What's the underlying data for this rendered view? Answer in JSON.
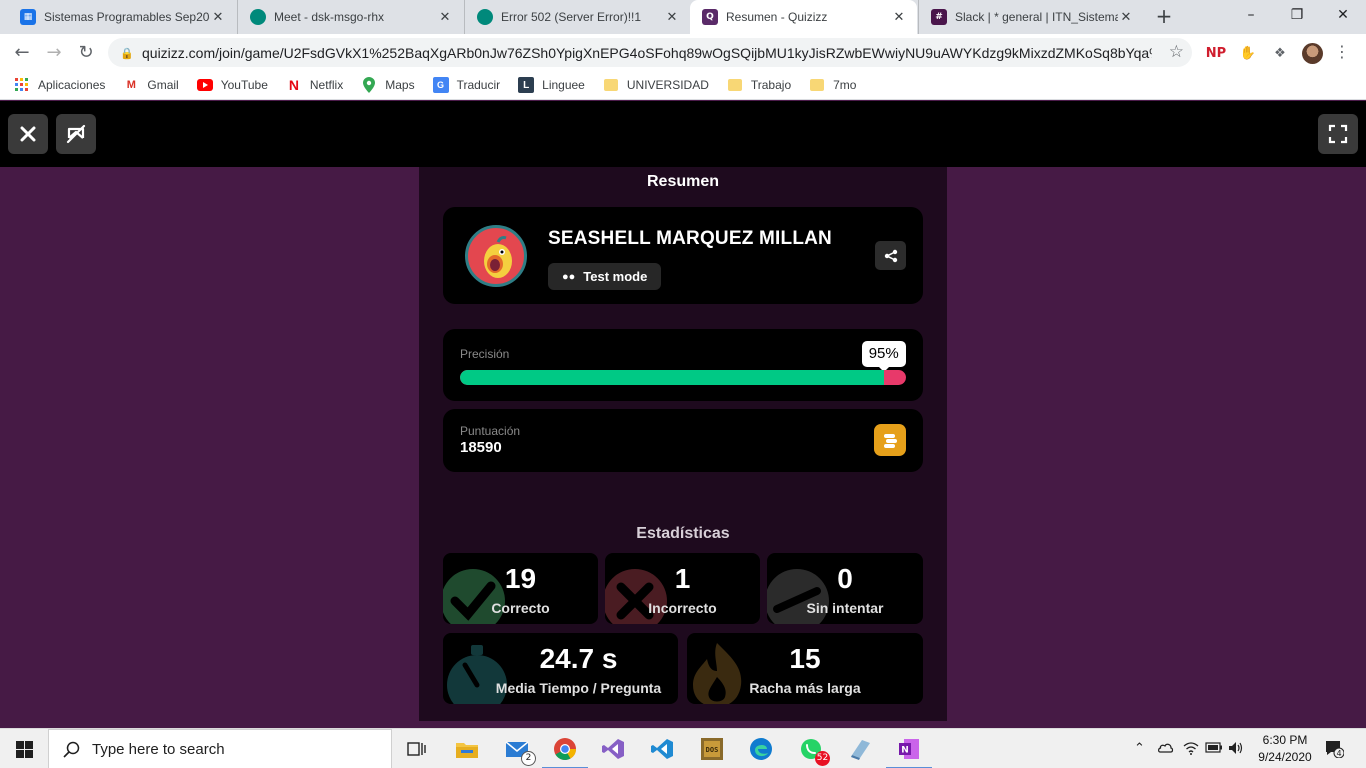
{
  "browser": {
    "tabs": [
      {
        "title": "Sistemas Programables Sep20-",
        "favicon_color": "#1a73e8",
        "icon": "classroom-icon"
      },
      {
        "title": "Meet - dsk-msgo-rhx",
        "favicon_color": "#00897b",
        "icon": "meet-icon"
      },
      {
        "title": "Error 502 (Server Error)!!1",
        "favicon_color": "#00897b",
        "icon": "meet-icon"
      },
      {
        "title": "Resumen - Quizizz",
        "favicon_color": "#5a2a68",
        "icon": "quizizz-icon"
      },
      {
        "title": "Slack | * general | ITN_Sistemas",
        "favicon_color": "#4a154b",
        "icon": "slack-icon"
      }
    ],
    "active_tab_index": 3,
    "url": "quizizz.com/join/game/U2FsdGVkX1%252BaqXgARb0nJw76ZSh0YpigXnEPG4oSFohq89wOgSQijbMU1kyJisRZwbEWwiyNU9uAWYKdzg9kMixzdZMKoSq8bYqa%25...",
    "extension_np": "NP",
    "bookmarks": [
      {
        "label": "Aplicaciones",
        "icon": "apps-grid-icon"
      },
      {
        "label": "Gmail",
        "icon": "gmail-icon"
      },
      {
        "label": "YouTube",
        "icon": "youtube-icon"
      },
      {
        "label": "Netflix",
        "icon": "netflix-icon"
      },
      {
        "label": "Maps",
        "icon": "maps-icon"
      },
      {
        "label": "Traducir",
        "icon": "translate-icon"
      },
      {
        "label": "Linguee",
        "icon": "linguee-icon"
      },
      {
        "label": "UNIVERSIDAD",
        "icon": "folder-icon"
      },
      {
        "label": "Trabajo",
        "icon": "folder-icon"
      },
      {
        "label": "7mo",
        "icon": "folder-icon"
      }
    ]
  },
  "summary": {
    "title": "Resumen",
    "player": {
      "name": "SEASHELL MARQUEZ MILLAN",
      "mode": "Test mode"
    },
    "accuracy": {
      "label": "Precisión",
      "value_text": "95%",
      "value": 0.95
    },
    "score": {
      "label": "Puntuación",
      "value": "18590"
    },
    "stats_title": "Estadísticas",
    "stats": {
      "correct": {
        "value": "19",
        "label": "Correcto"
      },
      "incorrect": {
        "value": "1",
        "label": "Incorrecto"
      },
      "unattempted": {
        "value": "0",
        "label": "Sin intentar"
      },
      "avg_time": {
        "value": "24.7 s",
        "label": "Media Tiempo / Pregunta"
      },
      "streak": {
        "value": "15",
        "label": "Racha más larga"
      }
    }
  },
  "colors": {
    "correct": "#00c985",
    "incorrect": "#e8396a",
    "coin": "#e6a01a",
    "page_bg": "#461a45",
    "panel_bg": "#1e0a1e"
  },
  "taskbar": {
    "search_placeholder": "Type here to search",
    "mail_badge": "2",
    "whatsapp_badge": "52",
    "time": "6:30 PM",
    "date": "9/24/2020",
    "notifications": "4"
  }
}
